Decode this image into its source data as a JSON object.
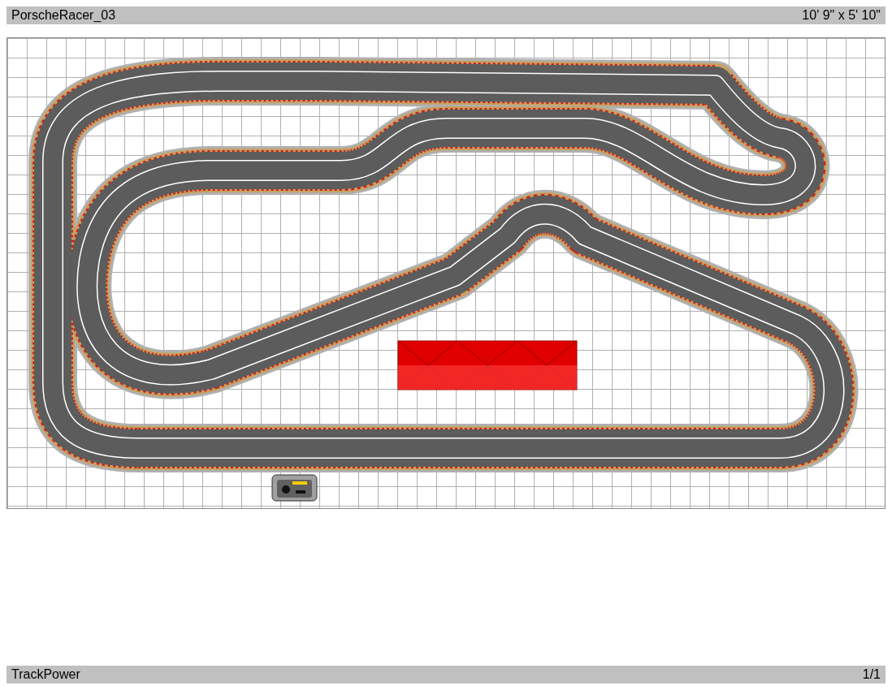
{
  "header": {
    "title": "PorscheRacer_03",
    "dimensions": "10' 9\" x 5' 10\""
  },
  "footer": {
    "program": "TrackPower",
    "page": "1/1"
  }
}
